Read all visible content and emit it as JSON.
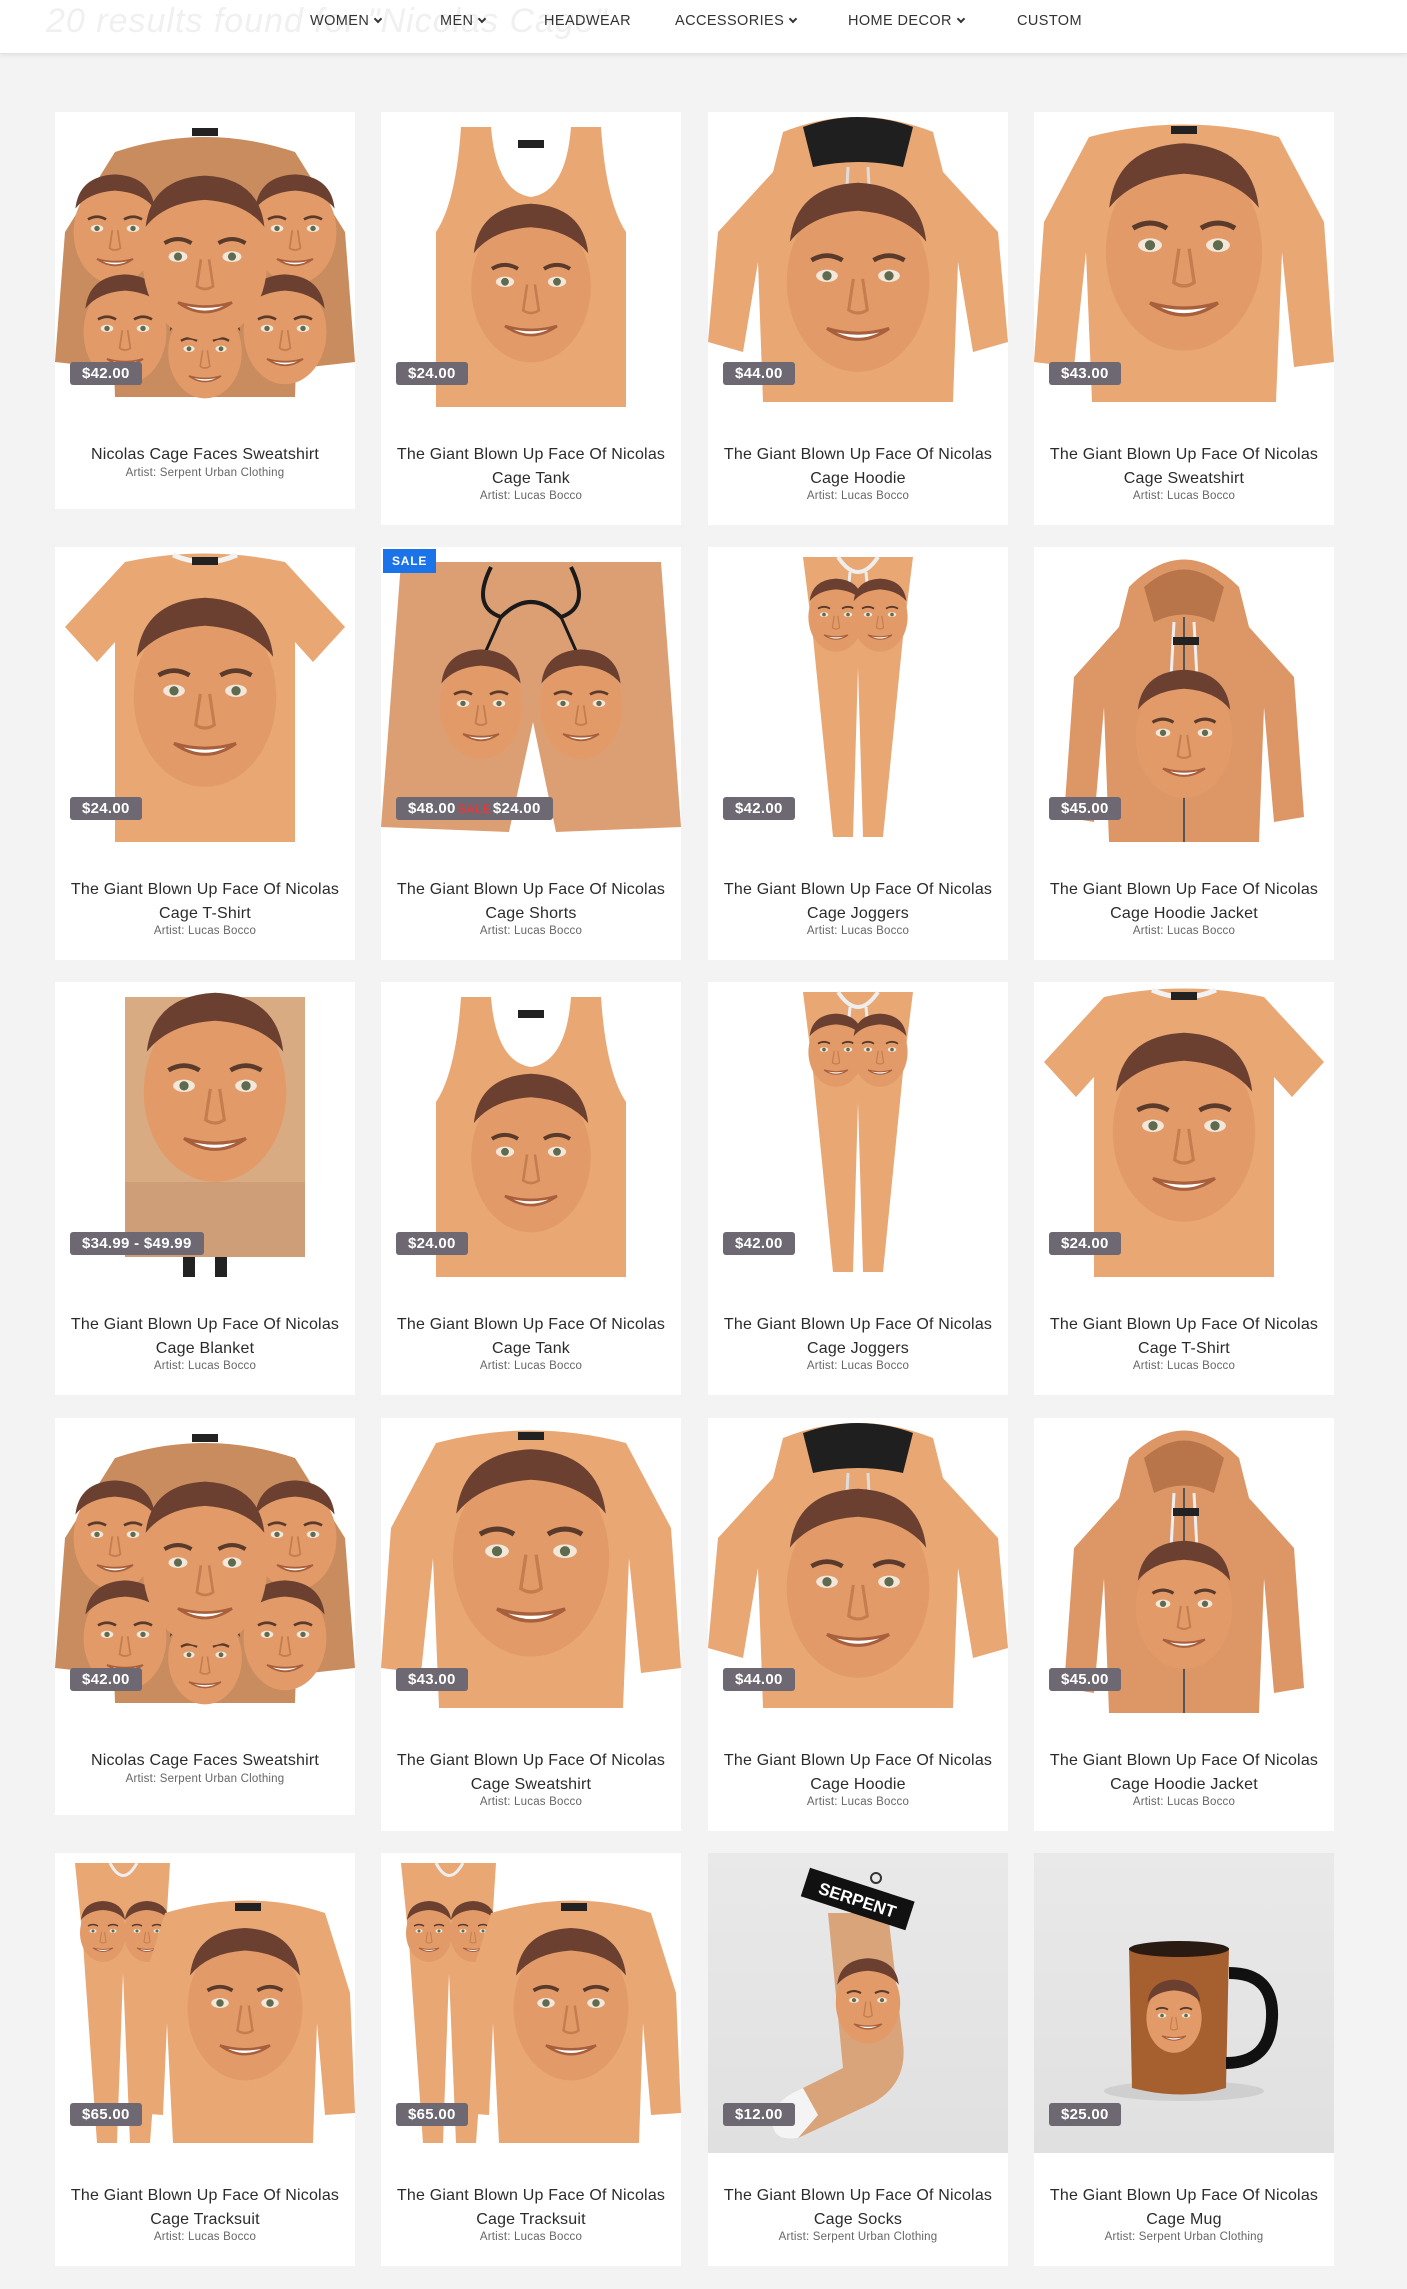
{
  "header": {
    "results_text": "20 results found for \"Nicolas Cage\"",
    "nav": [
      {
        "label": "WOMEN",
        "dropdown": true
      },
      {
        "label": "MEN",
        "dropdown": true
      },
      {
        "label": "HEADWEAR",
        "dropdown": false
      },
      {
        "label": "ACCESSORIES",
        "dropdown": true
      },
      {
        "label": "HOME DECOR",
        "dropdown": true
      },
      {
        "label": "CUSTOM",
        "dropdown": false
      }
    ]
  },
  "colors": {
    "price_tag": "#6d6871",
    "sale_badge": "#1a73e8",
    "sale_mark": "#e63939",
    "skin": "#e9a774"
  },
  "products": [
    {
      "title": "Nicolas Cage Faces Sweatshirt",
      "artist": "Artist: Serpent Urban Clothing",
      "price": "$42.00",
      "icon": "sweatshirt-faces-icon"
    },
    {
      "title": "The Giant Blown Up Face Of Nicolas Cage Tank",
      "artist": "Artist: Lucas Bocco",
      "price": "$24.00",
      "icon": "tank-top-icon"
    },
    {
      "title": "The Giant Blown Up Face Of Nicolas Cage Hoodie",
      "artist": "Artist: Lucas Bocco",
      "price": "$44.00",
      "icon": "hoodie-icon"
    },
    {
      "title": "The Giant Blown Up Face Of Nicolas Cage Sweatshirt",
      "artist": "Artist: Lucas Bocco",
      "price": "$43.00",
      "icon": "sweatshirt-icon"
    },
    {
      "title": "The Giant Blown Up Face Of Nicolas Cage T-Shirt",
      "artist": "Artist: Lucas Bocco",
      "price": "$24.00",
      "icon": "tshirt-icon"
    },
    {
      "title": "The Giant Blown Up Face Of Nicolas Cage Shorts",
      "artist": "Artist: Lucas Bocco",
      "price": "$24.00",
      "original_price": "$48.00",
      "sale_mark": "SALE",
      "badge": "SALE",
      "icon": "shorts-icon"
    },
    {
      "title": "The Giant Blown Up Face Of Nicolas Cage Joggers",
      "artist": "Artist: Lucas Bocco",
      "price": "$42.00",
      "icon": "joggers-icon"
    },
    {
      "title": "The Giant Blown Up Face Of Nicolas Cage Hoodie Jacket",
      "artist": "Artist: Lucas Bocco",
      "price": "$45.00",
      "icon": "hoodie-jacket-icon"
    },
    {
      "title": "The Giant Blown Up Face Of Nicolas Cage Blanket",
      "artist": "Artist: Lucas Bocco",
      "price": "$34.99 - $49.99",
      "icon": "blanket-icon"
    },
    {
      "title": "The Giant Blown Up Face Of Nicolas Cage Tank",
      "artist": "Artist: Lucas Bocco",
      "price": "$24.00",
      "icon": "tank-top-icon"
    },
    {
      "title": "The Giant Blown Up Face Of Nicolas Cage Joggers",
      "artist": "Artist: Lucas Bocco",
      "price": "$42.00",
      "icon": "joggers-icon"
    },
    {
      "title": "The Giant Blown Up Face Of Nicolas Cage T-Shirt",
      "artist": "Artist: Lucas Bocco",
      "price": "$24.00",
      "icon": "tshirt-icon"
    },
    {
      "title": "Nicolas Cage Faces Sweatshirt",
      "artist": "Artist: Serpent Urban Clothing",
      "price": "$42.00",
      "icon": "sweatshirt-faces-icon"
    },
    {
      "title": "The Giant Blown Up Face Of Nicolas Cage Sweatshirt",
      "artist": "Artist: Lucas Bocco",
      "price": "$43.00",
      "icon": "sweatshirt-icon"
    },
    {
      "title": "The Giant Blown Up Face Of Nicolas Cage Hoodie",
      "artist": "Artist: Lucas Bocco",
      "price": "$44.00",
      "icon": "hoodie-icon"
    },
    {
      "title": "The Giant Blown Up Face Of Nicolas Cage Hoodie Jacket",
      "artist": "Artist: Lucas Bocco",
      "price": "$45.00",
      "icon": "hoodie-jacket-icon"
    },
    {
      "title": "The Giant Blown Up Face Of Nicolas Cage Tracksuit",
      "artist": "Artist: Lucas Bocco",
      "price": "$65.00",
      "icon": "tracksuit-icon"
    },
    {
      "title": "The Giant Blown Up Face Of Nicolas Cage Tracksuit",
      "artist": "Artist: Lucas Bocco",
      "price": "$65.00",
      "icon": "tracksuit-icon"
    },
    {
      "title": "The Giant Blown Up Face Of Nicolas Cage Socks",
      "artist": "Artist: Serpent Urban Clothing",
      "price": "$12.00",
      "brand_tag": "SERPENT",
      "icon": "socks-icon"
    },
    {
      "title": "The Giant Blown Up Face Of Nicolas Cage Mug",
      "artist": "Artist: Serpent Urban Clothing",
      "price": "$25.00",
      "icon": "mug-icon"
    }
  ]
}
